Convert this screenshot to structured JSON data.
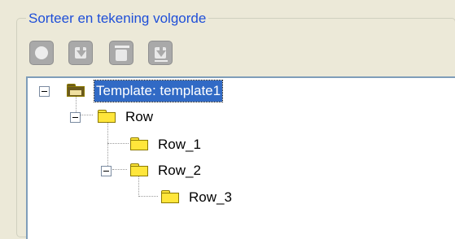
{
  "groupbox": {
    "title": "Sorteer en tekening volgorde"
  },
  "toolbar": {
    "buttons": [
      {
        "icon": "move-top-icon",
        "enabled": false
      },
      {
        "icon": "move-down-icon",
        "enabled": false
      },
      {
        "icon": "move-bottom-icon",
        "enabled": false
      },
      {
        "icon": "move-down-icon",
        "enabled": false
      }
    ]
  },
  "tree": {
    "nodes": [
      {
        "label": "Template: template1",
        "level": 0,
        "selected": true,
        "expanded": true
      },
      {
        "label": "Row",
        "level": 1,
        "selected": false,
        "expanded": true
      },
      {
        "label": "Row_1",
        "level": 2,
        "selected": false,
        "expanded": false
      },
      {
        "label": "Row_2",
        "level": 2,
        "selected": false,
        "expanded": true
      },
      {
        "label": "Row_3",
        "level": 3,
        "selected": false,
        "expanded": false
      }
    ]
  },
  "colors": {
    "title": "#1f4fd8",
    "selection": "#316ac5",
    "folder": "#ffe63b"
  }
}
